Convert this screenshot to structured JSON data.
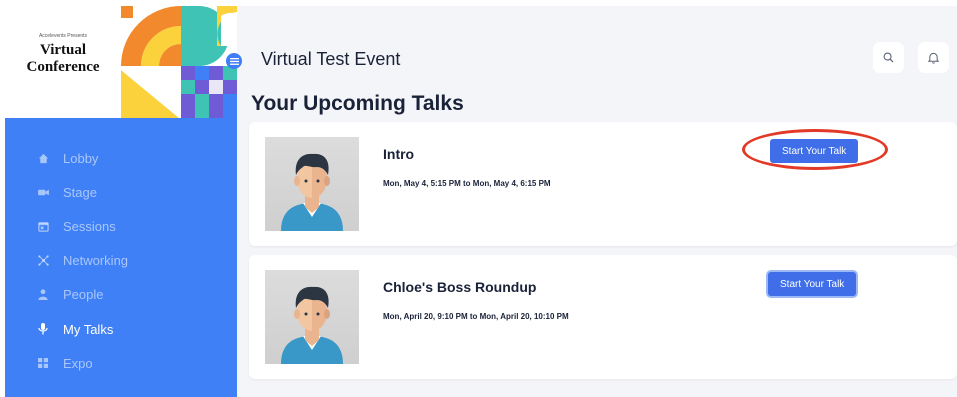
{
  "brand": {
    "presents": "Accelevents Presents",
    "title_line1": "Virtual",
    "title_line2": "Conference"
  },
  "sidebar": {
    "items": [
      {
        "label": "Lobby",
        "icon": "home-icon",
        "active": false
      },
      {
        "label": "Stage",
        "icon": "video-icon",
        "active": false
      },
      {
        "label": "Sessions",
        "icon": "calendar-icon",
        "active": false
      },
      {
        "label": "Networking",
        "icon": "network-icon",
        "active": false
      },
      {
        "label": "People",
        "icon": "person-icon",
        "active": false
      },
      {
        "label": "My Talks",
        "icon": "microphone-icon",
        "active": true
      },
      {
        "label": "Expo",
        "icon": "grid-icon",
        "active": false
      }
    ]
  },
  "header": {
    "event_title": "Virtual Test Event",
    "icons": [
      "search-icon",
      "bell-icon"
    ]
  },
  "main": {
    "page_title": "Your Upcoming Talks",
    "talks": [
      {
        "title": "Intro",
        "time": "Mon, May 4, 5:15 PM to Mon, May 4, 6:15 PM",
        "button_label": "Start Your Talk"
      },
      {
        "title": "Chloe's Boss Roundup",
        "time": "Mon, April 20, 9:10 PM to Mon, April 20, 10:10 PM",
        "button_label": "Start Your Talk"
      }
    ]
  },
  "colors": {
    "sidebar_bg": "#3f80f7",
    "button_bg": "#3f6ee8",
    "highlight": "#e23a26",
    "page_bg": "#f4f5f9",
    "text_dark": "#1a2238"
  }
}
